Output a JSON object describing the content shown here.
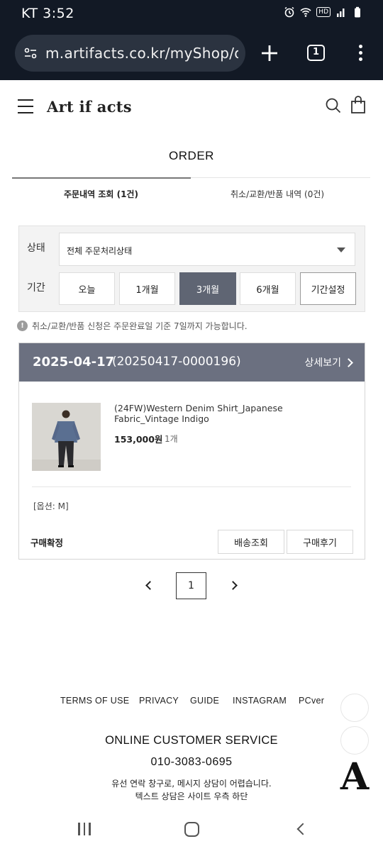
{
  "status_bar": {
    "time": "KT 3:52",
    "icons": [
      "alarm-icon",
      "wifi-icon",
      "hd-badge",
      "signal-icon",
      "battery-icon"
    ],
    "hd_label": "HD"
  },
  "browser": {
    "url": "m.artifacts.co.kr/myShop/o",
    "tab_count": "1",
    "icons": [
      "site-settings-icon",
      "new-tab-plus-icon",
      "tabs-icon",
      "menu-kebab-icon"
    ]
  },
  "site": {
    "logo": "Art if acts",
    "icons": [
      "hamburger-menu-icon",
      "search-icon",
      "shopping-bag-icon"
    ]
  },
  "page": {
    "title": "ORDER"
  },
  "tabs": [
    {
      "label": "주문내역 조회 (1건)",
      "active": true
    },
    {
      "label": "취소/교환/반품 내역 (0건)",
      "active": false
    }
  ],
  "filter": {
    "status_label": "상태",
    "status_value": "전체 주문처리상태",
    "period_label": "기간",
    "period_options": [
      "오늘",
      "1개월",
      "3개월",
      "6개월",
      "기간설정"
    ],
    "period_selected": "3개월"
  },
  "notice": {
    "icon_text": "!",
    "text": "취소/교환/반품 신청은 주문완료일 기준 7일까지 가능합니다."
  },
  "order": {
    "date": "2025-04-17",
    "order_no": "(20250417-0000196)",
    "detail_label": "상세보기",
    "item": {
      "name": "(24FW)Western Denim Shirt_Japanese Fabric_Vintage Indigo",
      "price": "153,000원",
      "qty": "1개",
      "option": "[옵션: M]"
    },
    "status": "구매확정",
    "buttons": [
      "배송조회",
      "구매후기"
    ]
  },
  "pagination": {
    "current": "1"
  },
  "footer": {
    "links": [
      "TERMS OF USE",
      "PRIVACY",
      "GUIDE",
      "INSTAGRAM",
      "PCver"
    ],
    "cs_title": "ONLINE CUSTOMER SERVICE",
    "cs_phone": "010-3083-0695",
    "cs_note1": "유선 연락 창구로, 메시지 상담이 어렵습니다.",
    "cs_note2": "텍스트 상담은 사이트 우측 하단",
    "floating_logo": "A"
  },
  "colors": {
    "browser_bg": "#121925",
    "order_header": "#6b7080",
    "active_period": "#5f6573"
  }
}
